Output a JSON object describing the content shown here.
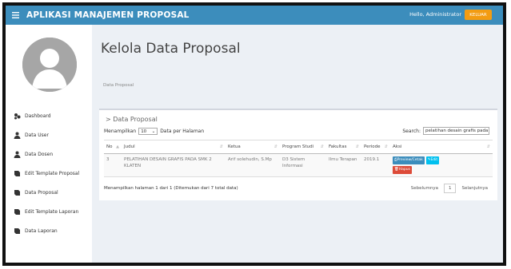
{
  "header": {
    "app_title": "APLIKASI MANAJEMEN PROPOSAL",
    "greeting": "Hello, Administrator",
    "logout_label": "KELUAR"
  },
  "sidebar": {
    "items": [
      {
        "label": "Dashboard",
        "icon": "dashboard-icon"
      },
      {
        "label": "Data User",
        "icon": "user-icon"
      },
      {
        "label": "Data Dosen",
        "icon": "user-icon"
      },
      {
        "label": "Edit Template Proposal",
        "icon": "book-icon"
      },
      {
        "label": "Data Proposal",
        "icon": "book-icon"
      },
      {
        "label": "Edit Template Laporan",
        "icon": "book-icon"
      },
      {
        "label": "Data Laporan",
        "icon": "book-icon"
      }
    ]
  },
  "main": {
    "page_title": "Kelola Data Proposal",
    "breadcrumb": "Data Proposal",
    "box_title": "> Data Proposal",
    "show_prefix": "Menampilkan",
    "entries_value": "10",
    "show_suffix": "Data per Halaman",
    "search_label": "Search:",
    "search_value": "pelatihan desain grafis pada",
    "table": {
      "columns": [
        "No",
        "Judul",
        "Ketua",
        "Program Studi",
        "Fakultas",
        "Periode",
        "Aksi"
      ],
      "rows": [
        {
          "no": "3",
          "judul": "PELATIHAN DESAIN GRAFIS PADA SMK 2 KLATEN",
          "ketua": "Arif solehudin, S.Mp",
          "prodi": "D3 Sistem Informasi",
          "fakultas": "Ilmu Terapan",
          "periode": "2019.1",
          "actions": {
            "preview": "Preview/Cetak",
            "edit": "Edit",
            "delete": "Hapus"
          }
        }
      ]
    },
    "info_text": "Menampilkan halaman 1 dari 1 (Ditemukan dari 7 total data)",
    "pager": {
      "prev": "Sebelumnya",
      "current": "1",
      "next": "Selanjutnya"
    }
  },
  "colors": {
    "topbar": "#3c8dbc",
    "logout": "#f39c12",
    "preview_btn": "#3c8dbc",
    "edit_btn": "#00c0ef",
    "delete_btn": "#dd4b39"
  }
}
